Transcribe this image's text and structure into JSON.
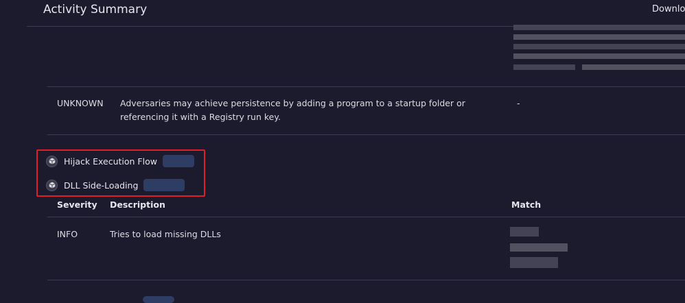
{
  "header": {
    "title": "Activity Summary",
    "download_label": "Downloa"
  },
  "unknown_row": {
    "severity": "UNKNOWN",
    "description": "Adversaries may achieve persistence by adding a program to a startup folder or referencing it with a Registry run key.",
    "match": "-"
  },
  "techniques": [
    {
      "icon": "cube-icon",
      "label": "Hijack Execution Flow"
    },
    {
      "icon": "cube-icon",
      "label": "DLL Side-Loading"
    }
  ],
  "table": {
    "headers": {
      "severity": "Severity",
      "description": "Description",
      "match": "Match"
    },
    "rows": [
      {
        "severity": "INFO",
        "description": "Tries to load missing DLLs"
      }
    ]
  },
  "colors": {
    "highlight_box": "#e01e2a",
    "background": "#1b1b2d",
    "tag": "#2d3d63"
  }
}
